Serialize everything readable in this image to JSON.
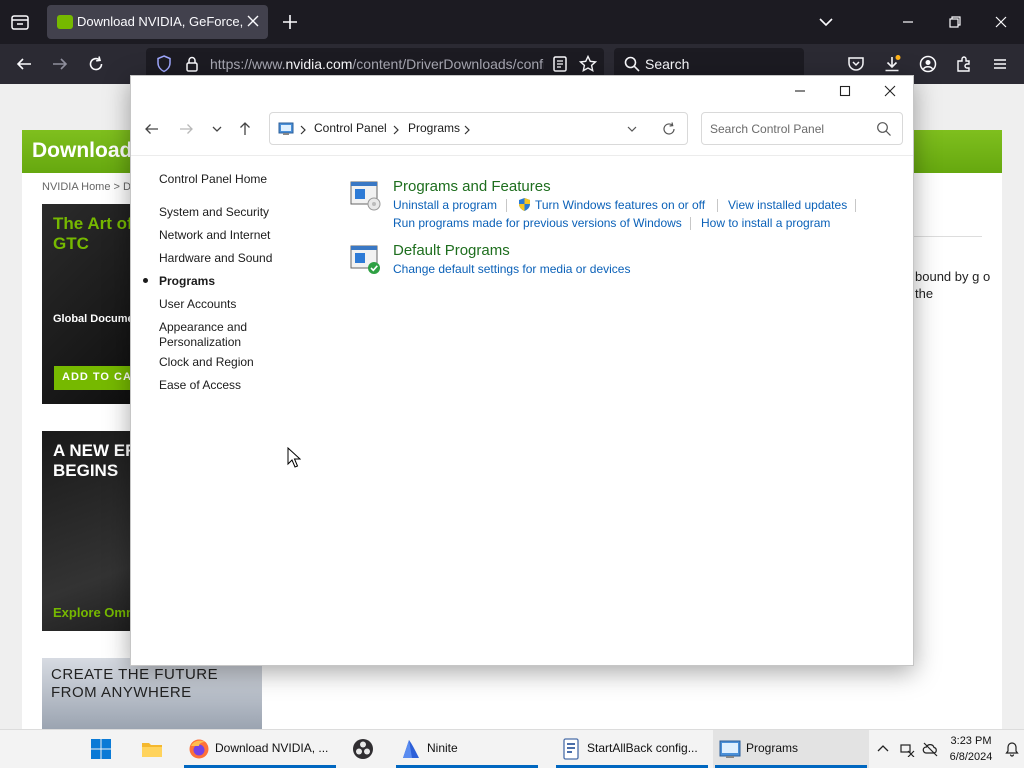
{
  "browser": {
    "tab_title": "Download NVIDIA, GeForce, Quadro",
    "url_prefix": "https://www.",
    "url_domain": "nvidia.com",
    "url_rest": "/content/DriverDownloads/confirmation.php",
    "search_placeholder": "Search"
  },
  "webpage": {
    "header": "Download",
    "breadcrumb": "NVIDIA Home > D",
    "promo1_title": "The Art of NVIDIA, O and GTC",
    "promo1_sub": "Global Docume Premiere",
    "promo1_button": "ADD TO CALE",
    "promo2_title": "A NEW ER COLLABO BEGINS",
    "promo2_cta": "Explore Omn",
    "promo3_title": "CREATE THE FUTURE FROM ANYWHERE",
    "side_text": "bound by g o the"
  },
  "control_panel": {
    "address": [
      "Control Panel",
      "Programs"
    ],
    "search_placeholder": "Search Control Panel",
    "sidebar": {
      "home": "Control Panel Home",
      "items": [
        "System and Security",
        "Network and Internet",
        "Hardware and Sound",
        "Programs",
        "User Accounts",
        "Appearance and Personalization",
        "Clock and Region",
        "Ease of Access"
      ],
      "current": "Programs"
    },
    "categories": [
      {
        "title": "Programs and Features",
        "links": [
          "Uninstall a program",
          "Turn Windows features on or off",
          "View installed updates",
          "Run programs made for previous versions of Windows",
          "How to install a program"
        ]
      },
      {
        "title": "Default Programs",
        "links": [
          "Change default settings for media or devices"
        ]
      }
    ]
  },
  "taskbar": {
    "apps": [
      {
        "label": "Download NVIDIA, ..."
      },
      {
        "label": "Ninite"
      },
      {
        "label": "StartAllBack config..."
      },
      {
        "label": "Programs"
      }
    ],
    "time": "3:23 PM",
    "date": "6/8/2024"
  }
}
